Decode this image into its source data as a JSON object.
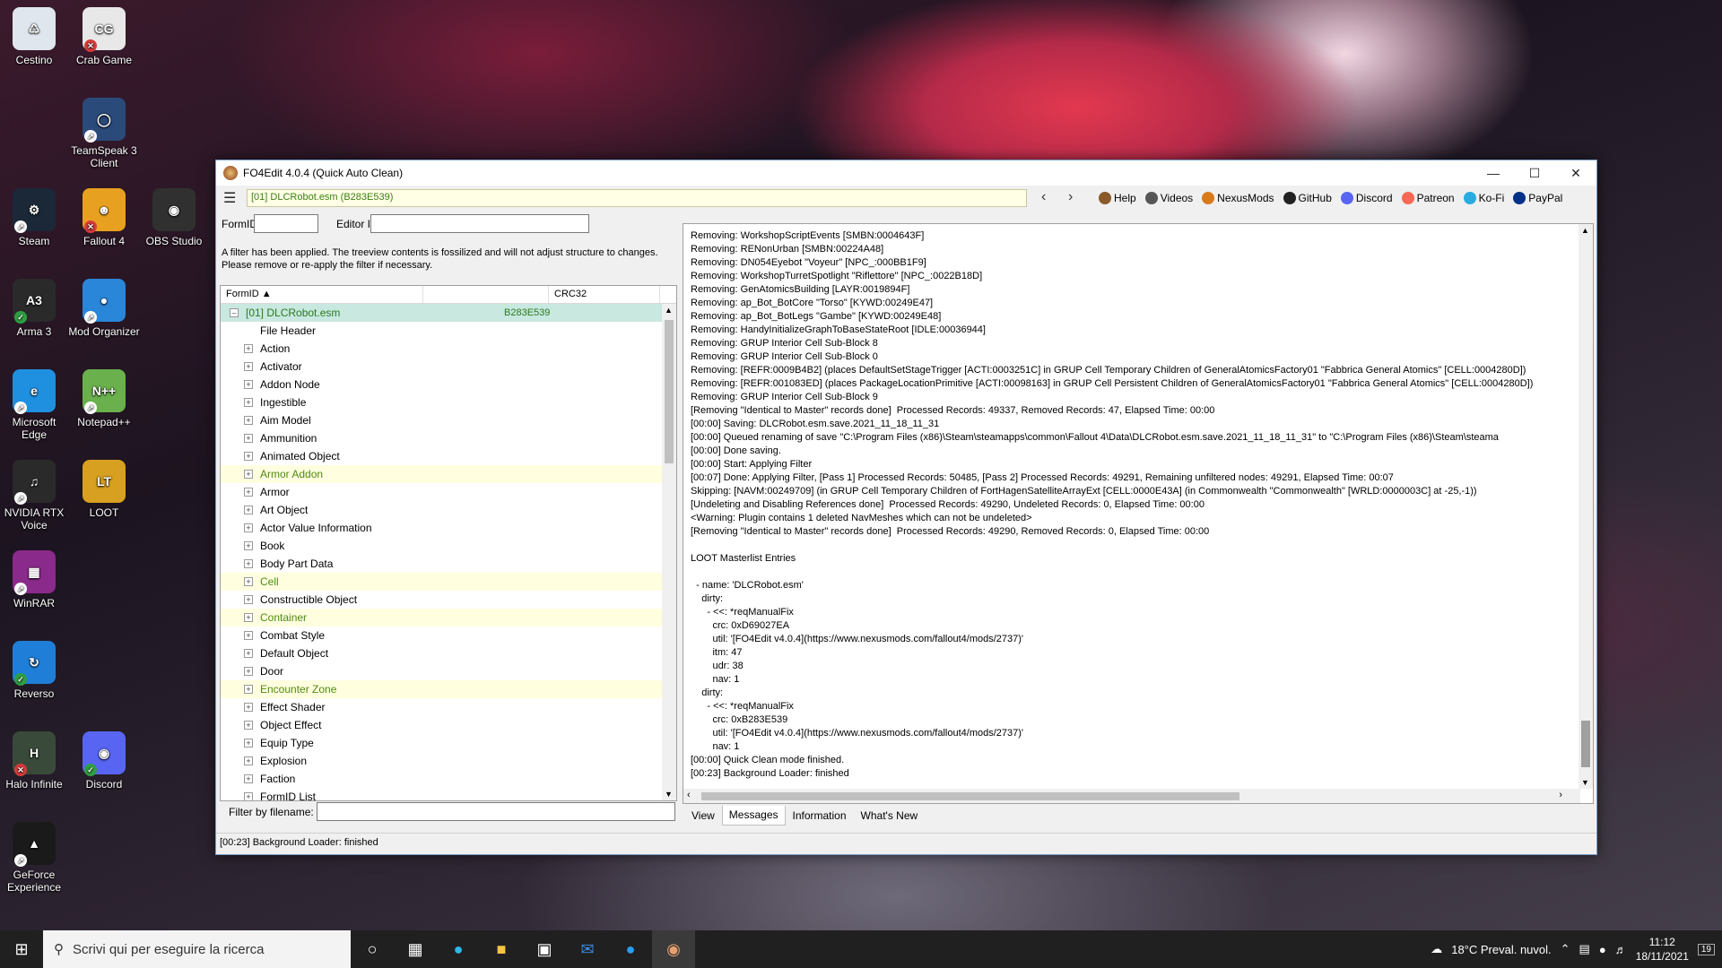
{
  "desktop": {
    "icons": [
      {
        "label": "Cestino"
      },
      {
        "label": "Crab Game"
      },
      {
        "label": "TeamSpeak 3 Client"
      },
      {
        "label": "Steam"
      },
      {
        "label": "Fallout 4"
      },
      {
        "label": "OBS Studio"
      },
      {
        "label": "Arma 3"
      },
      {
        "label": "Mod Organizer"
      },
      {
        "label": "Microsoft Edge"
      },
      {
        "label": "Notepad++"
      },
      {
        "label": "NVIDIA RTX Voice"
      },
      {
        "label": "LOOT"
      },
      {
        "label": "WinRAR"
      },
      {
        "label": "Reverso"
      },
      {
        "label": "Halo Infinite"
      },
      {
        "label": "Discord"
      },
      {
        "label": "GeForce Experience"
      }
    ]
  },
  "window": {
    "title": "FO4Edit 4.0.4 (Quick Auto Clean)"
  },
  "toolbar": {
    "path": "[01] DLCRobot.esm (B283E539)",
    "links": [
      {
        "label": "Help",
        "color": "#8a5a2a"
      },
      {
        "label": "Videos",
        "color": "#555555"
      },
      {
        "label": "NexusMods",
        "color": "#d97a1a"
      },
      {
        "label": "GitHub",
        "color": "#222222"
      },
      {
        "label": "Discord",
        "color": "#5865f2"
      },
      {
        "label": "Patreon",
        "color": "#f96854"
      },
      {
        "label": "Ko-Fi",
        "color": "#29abe0"
      },
      {
        "label": "PayPal",
        "color": "#003087"
      }
    ]
  },
  "filters": {
    "formid_label": "FormID",
    "editorid_label": "Editor ID",
    "formid_value": "",
    "editorid_value": "",
    "note": "A filter has been applied. The treeview contents is fossilized and will not adjust structure to changes.  Please remove or re-apply the filter if necessary.",
    "filename_label": "Filter by filename:",
    "filename_value": ""
  },
  "tree": {
    "col_formid": "FormID",
    "col_crc": "CRC32",
    "root": {
      "label": "[01] DLCRobot.esm",
      "crc": "B283E539"
    },
    "items": [
      {
        "label": "File Header",
        "exp": false,
        "hl": false
      },
      {
        "label": "Action",
        "exp": true,
        "hl": false
      },
      {
        "label": "Activator",
        "exp": true,
        "hl": false
      },
      {
        "label": "Addon Node",
        "exp": true,
        "hl": false
      },
      {
        "label": "Ingestible",
        "exp": true,
        "hl": false
      },
      {
        "label": "Aim Model",
        "exp": true,
        "hl": false
      },
      {
        "label": "Ammunition",
        "exp": true,
        "hl": false
      },
      {
        "label": "Animated Object",
        "exp": true,
        "hl": false
      },
      {
        "label": "Armor Addon",
        "exp": true,
        "hl": true
      },
      {
        "label": "Armor",
        "exp": true,
        "hl": false
      },
      {
        "label": "Art Object",
        "exp": true,
        "hl": false
      },
      {
        "label": "Actor Value Information",
        "exp": true,
        "hl": false
      },
      {
        "label": "Book",
        "exp": true,
        "hl": false
      },
      {
        "label": "Body Part Data",
        "exp": true,
        "hl": false
      },
      {
        "label": "Cell",
        "exp": true,
        "hl": true
      },
      {
        "label": "Constructible Object",
        "exp": true,
        "hl": false
      },
      {
        "label": "Container",
        "exp": true,
        "hl": true
      },
      {
        "label": "Combat Style",
        "exp": true,
        "hl": false
      },
      {
        "label": "Default Object",
        "exp": true,
        "hl": false
      },
      {
        "label": "Door",
        "exp": true,
        "hl": false
      },
      {
        "label": "Encounter Zone",
        "exp": true,
        "hl": true
      },
      {
        "label": "Effect Shader",
        "exp": true,
        "hl": false
      },
      {
        "label": "Object Effect",
        "exp": true,
        "hl": false
      },
      {
        "label": "Equip Type",
        "exp": true,
        "hl": false
      },
      {
        "label": "Explosion",
        "exp": true,
        "hl": false
      },
      {
        "label": "Faction",
        "exp": true,
        "hl": false
      },
      {
        "label": "FormID List",
        "exp": true,
        "hl": false
      }
    ]
  },
  "log": {
    "lines": [
      "Removing: WorkshopScriptEvents [SMBN:0004643F]",
      "Removing: RENonUrban [SMBN:00224A48]",
      "Removing: DN054Eyebot \"Voyeur\" [NPC_:000BB1F9]",
      "Removing: WorkshopTurretSpotlight \"Riflettore\" [NPC_:0022B18D]",
      "Removing: GenAtomicsBuilding [LAYR:0019894F]",
      "Removing: ap_Bot_BotCore \"Torso\" [KYWD:00249E47]",
      "Removing: ap_Bot_BotLegs \"Gambe\" [KYWD:00249E48]",
      "Removing: HandyInitializeGraphToBaseStateRoot [IDLE:00036944]",
      "Removing: GRUP Interior Cell Sub-Block 8",
      "Removing: GRUP Interior Cell Sub-Block 0",
      "Removing: [REFR:0009B4B2] (places DefaultSetStageTrigger [ACTI:0003251C] in GRUP Cell Temporary Children of GeneralAtomicsFactory01 \"Fabbrica General Atomics\" [CELL:0004280D])",
      "Removing: [REFR:001083ED] (places PackageLocationPrimitive [ACTI:00098163] in GRUP Cell Persistent Children of GeneralAtomicsFactory01 \"Fabbrica General Atomics\" [CELL:0004280D])",
      "Removing: GRUP Interior Cell Sub-Block 9",
      "[Removing \"Identical to Master\" records done]  Processed Records: 49337, Removed Records: 47, Elapsed Time: 00:00",
      "[00:00] Saving: DLCRobot.esm.save.2021_11_18_11_31",
      "[00:00] Queued renaming of save \"C:\\Program Files (x86)\\Steam\\steamapps\\common\\Fallout 4\\Data\\DLCRobot.esm.save.2021_11_18_11_31\" to \"C:\\Program Files (x86)\\Steam\\steama",
      "[00:00] Done saving.",
      "[00:00] Start: Applying Filter",
      "[00:07] Done: Applying Filter, [Pass 1] Processed Records: 50485, [Pass 2] Processed Records: 49291, Remaining unfiltered nodes: 49291, Elapsed Time: 00:07",
      "Skipping: [NAVM:00249709] (in GRUP Cell Temporary Children of FortHagenSatelliteArrayExt [CELL:0000E43A] (in Commonwealth \"Commonwealth\" [WRLD:0000003C] at -25,-1))",
      "[Undeleting and Disabling References done]  Processed Records: 49290, Undeleted Records: 0, Elapsed Time: 00:00",
      "<Warning: Plugin contains 1 deleted NavMeshes which can not be undeleted>",
      "[Removing \"Identical to Master\" records done]  Processed Records: 49290, Removed Records: 0, Elapsed Time: 00:00",
      "",
      "LOOT Masterlist Entries",
      "",
      "  - name: 'DLCRobot.esm'",
      "    dirty:",
      "      - <<: *reqManualFix",
      "        crc: 0xD69027EA",
      "        util: '[FO4Edit v4.0.4](https://www.nexusmods.com/fallout4/mods/2737)'",
      "        itm: 47",
      "        udr: 38",
      "        nav: 1",
      "    dirty:",
      "      - <<: *reqManualFix",
      "        crc: 0xB283E539",
      "        util: '[FO4Edit v4.0.4](https://www.nexusmods.com/fallout4/mods/2737)'",
      "        nav: 1",
      "[00:00] Quick Clean mode finished.",
      "[00:23] Background Loader: finished"
    ]
  },
  "tabs": [
    {
      "label": "View",
      "active": false
    },
    {
      "label": "Messages",
      "active": true
    },
    {
      "label": "Information",
      "active": false
    },
    {
      "label": "What's New",
      "active": false
    }
  ],
  "status": "[00:23] Background Loader: finished",
  "taskbar": {
    "search_placeholder": "Scrivi qui per eseguire la ricerca",
    "weather": "18°C  Preval. nuvol.",
    "time": "11:12",
    "date": "18/11/2021",
    "notif": "19"
  }
}
